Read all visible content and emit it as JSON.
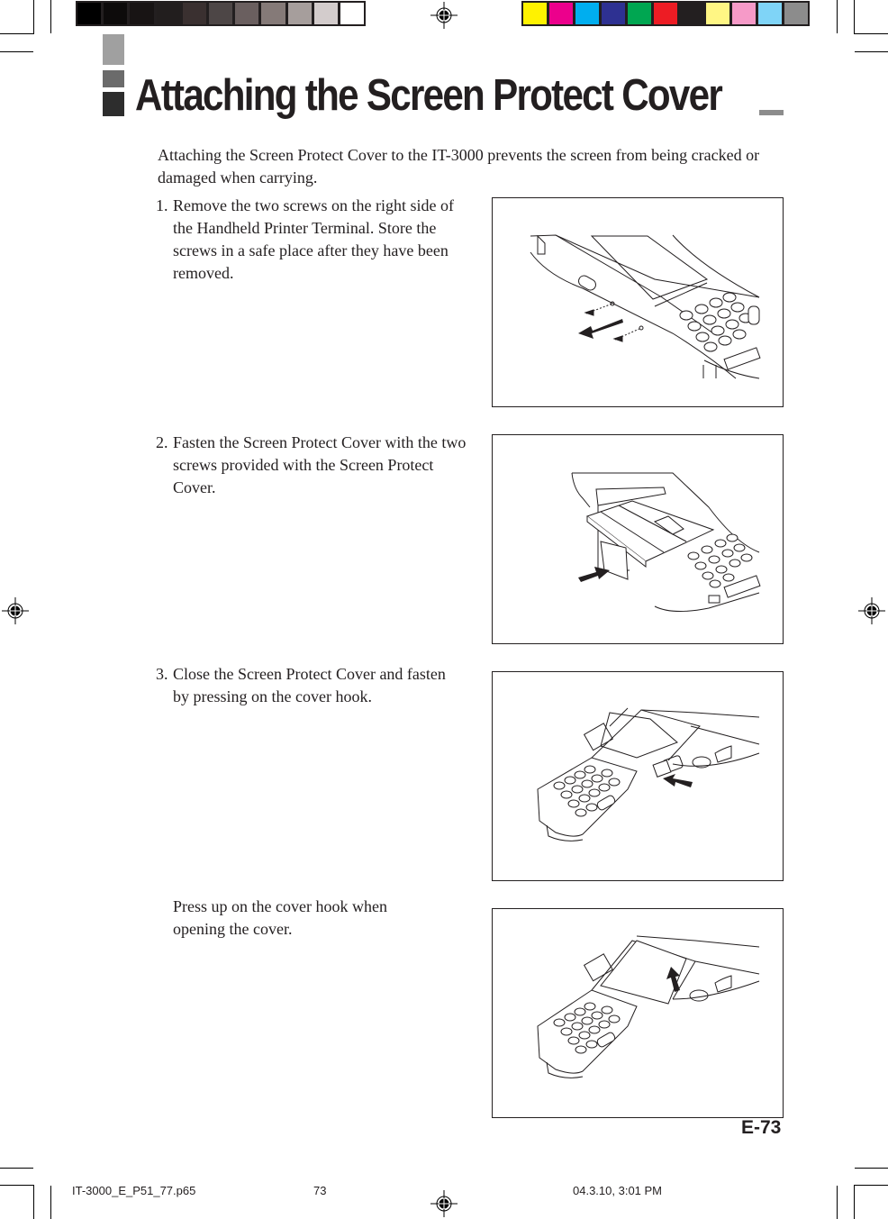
{
  "print_marks": {
    "gray_swatches": [
      "#000000",
      "#0d0b0b",
      "#181414",
      "#221e1e",
      "#3a3030",
      "#4d4646",
      "#6a5f5f",
      "#857a78",
      "#a69e9c",
      "#d3cccc",
      "#ffffff"
    ],
    "color_swatches": [
      "#fff200",
      "#ec008c",
      "#00aeef",
      "#2e3192",
      "#00a651",
      "#ed1c24",
      "#231f20",
      "#fff684",
      "#f69ac8",
      "#7fd4f7",
      "#8c8c8c"
    ]
  },
  "header": {
    "title": "Attaching the Screen Protect Cover",
    "block_colors": [
      "#a0a0a0",
      "#6b6b6b",
      "#2d2d2d"
    ]
  },
  "intro": "Attaching the Screen Protect Cover to the IT-3000 prevents the screen from being cracked or damaged when carrying.",
  "steps": [
    {
      "number": "1.",
      "text": "Remove the two screws on the right side of the Handheld Printer Terminal.  Store the screws in a safe place after they have been removed.",
      "figure": "Illustration: removing two screws from right side of terminal"
    },
    {
      "number": "2.",
      "text": "Fasten the Screen Protect Cover with the two screws provided with the Screen Protect Cover.",
      "figure": "Illustration: attaching screen protect cover with screws"
    },
    {
      "number": "3.",
      "text": "Close the Screen Protect Cover and fasten by pressing on the cover hook.",
      "figure": "Illustration: pressing on cover hook to close"
    },
    {
      "number": "",
      "text": "Press up on the cover hook when opening the cover.",
      "figure": "Illustration: pressing up on cover hook to open"
    }
  ],
  "footer": {
    "page_number": "E-73",
    "slug_file": "IT-3000_E_P51_77.p65",
    "slug_page": "73",
    "slug_date": "04.3.10, 3:01 PM"
  }
}
